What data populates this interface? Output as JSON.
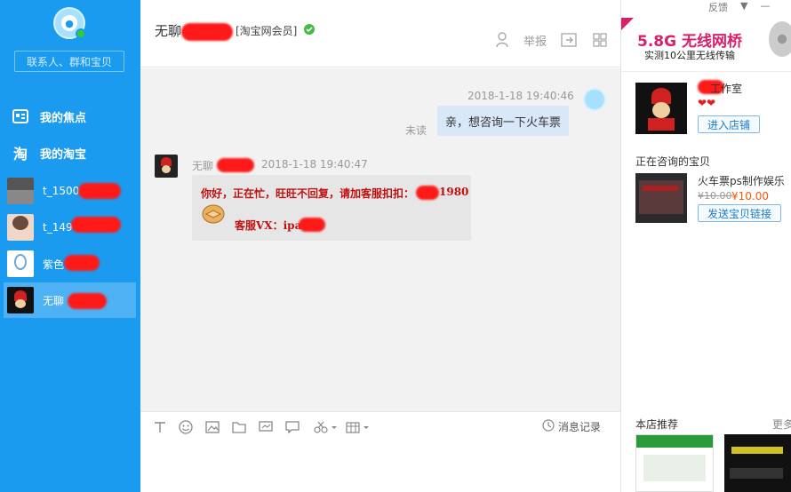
{
  "sidebar": {
    "search_placeholder": "联系人、群和宝贝",
    "nav": [
      {
        "label": "我的焦点",
        "icon": "focus-icon"
      },
      {
        "label": "我的淘宝",
        "icon": "taobao-icon"
      }
    ],
    "contacts": [
      {
        "name": "t_1500"
      },
      {
        "name": "t_149"
      },
      {
        "name": "紫色"
      },
      {
        "name": "无聊"
      }
    ]
  },
  "header": {
    "title": "无聊",
    "member_badge": "[淘宝网会员]",
    "report_label": "举报"
  },
  "chat": {
    "my_timestamp": "2018-1-18 19:40:46",
    "my_message": "亲，想咨询一下火车票",
    "unread_label": "未读",
    "their_name": "无聊",
    "their_timestamp": "2018-1-18 19:40:47",
    "auto_reply": "你好，正在忙，旺旺不回复，请加客服扣扣：",
    "auto_reply_qq_tail": "1980",
    "wx_label": "客服VX：ipad"
  },
  "toolbar": {
    "history_label": "消息记录"
  },
  "right_panel": {
    "window_controls": [
      "反馈",
      "▼",
      "—"
    ],
    "ad": {
      "title": "5.8G 无线网桥",
      "subtitle": "实测10公里无线传输"
    },
    "shop": {
      "name": "工作室",
      "hearts": "❤❤",
      "enter_button": "进入店铺"
    },
    "consulting": {
      "title": "正在咨询的宝贝",
      "item_title": "火车票ps制作娱乐",
      "price_old": "¥10.00",
      "price_new": "¥10.00",
      "send_button": "发送宝贝链接"
    },
    "recommend": {
      "title": "本店推荐",
      "more": "更多"
    }
  },
  "colors": {
    "sidebar_bg": "#1a9bef",
    "accent": "#1a9bef",
    "redaction": "#ff1a1a",
    "auto_reply_text": "#c01010"
  }
}
